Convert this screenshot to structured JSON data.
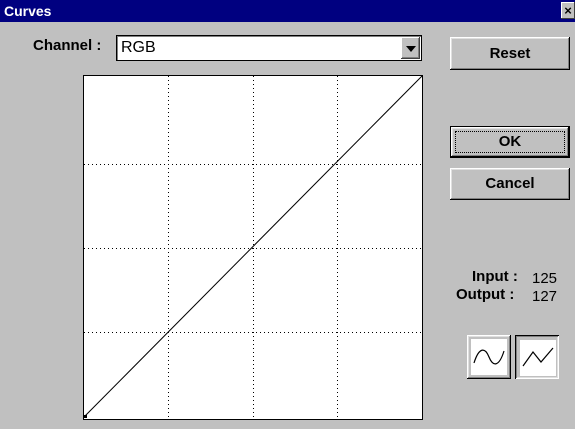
{
  "window": {
    "title": "Curves",
    "close_glyph": "×"
  },
  "channel": {
    "label": "Channel :",
    "selected": "RGB"
  },
  "buttons": {
    "reset": "Reset",
    "ok": "OK",
    "cancel": "Cancel"
  },
  "readouts": {
    "input_label": "Input :",
    "input_value": "125",
    "output_label": "Output :",
    "output_value": "127"
  },
  "curve_tools": [
    {
      "name": "smooth-curve",
      "icon": "smooth-curve-icon",
      "pressed": false
    },
    {
      "name": "linear-curve",
      "icon": "linear-curve-icon",
      "pressed": true
    }
  ],
  "colors": {
    "titlebar": "#000080",
    "face": "#c0c0c0"
  }
}
